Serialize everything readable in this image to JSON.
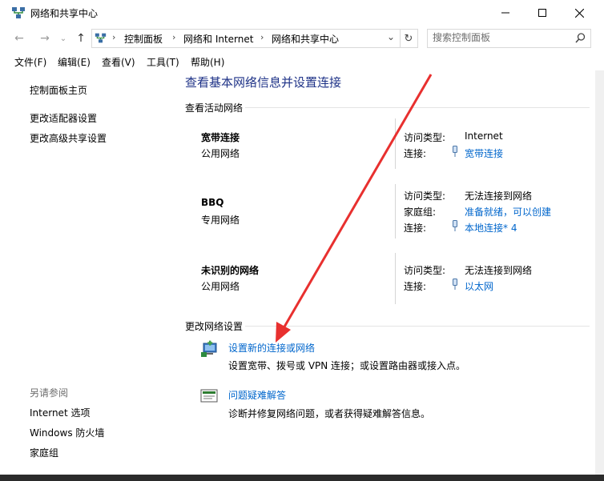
{
  "window": {
    "title": "网络和共享中心",
    "minimize_label": "Minimize",
    "maximize_label": "Maximize",
    "close_label": "Close"
  },
  "address": {
    "crumbs": [
      "控制面板",
      "网络和 Internet",
      "网络和共享中心"
    ],
    "search_placeholder": "搜索控制面板"
  },
  "menu": [
    "文件(F)",
    "编辑(E)",
    "查看(V)",
    "工具(T)",
    "帮助(H)"
  ],
  "sidebar": {
    "links": [
      "控制面板主页",
      "更改适配器设置",
      "更改高级共享设置"
    ],
    "see_also_title": "另请参阅",
    "see_also": [
      "Internet 选项",
      "Windows 防火墙",
      "家庭组"
    ]
  },
  "main": {
    "title": "查看基本网络信息并设置连接",
    "active_heading": "查看活动网络",
    "networks": [
      {
        "name": "宽带连接",
        "type": "公用网络",
        "rows": [
          {
            "label": "访问类型:",
            "value": "Internet",
            "link": false
          },
          {
            "label": "连接:",
            "value": "宽带连接",
            "link": true,
            "icon": "connection-icon"
          }
        ]
      },
      {
        "name": "BBQ",
        "type": "专用网络",
        "rows": [
          {
            "label": "访问类型:",
            "value": "无法连接到网络",
            "link": false
          },
          {
            "label": "家庭组:",
            "value": "准备就绪，可以创建",
            "link": true
          },
          {
            "label": "连接:",
            "value": "本地连接* 4",
            "link": true,
            "icon": "connection-icon"
          }
        ]
      },
      {
        "name": "未识别的网络",
        "type": "公用网络",
        "rows": [
          {
            "label": "访问类型:",
            "value": "无法连接到网络",
            "link": false
          },
          {
            "label": "连接:",
            "value": "以太网",
            "link": true,
            "icon": "connection-icon"
          }
        ]
      }
    ],
    "change_heading": "更改网络设置",
    "tasks": [
      {
        "link": "设置新的连接或网络",
        "desc": "设置宽带、拨号或 VPN 连接；或设置路由器或接入点。"
      },
      {
        "link": "问题疑难解答",
        "desc": "诊断并修复网络问题，或者获得疑难解答信息。"
      }
    ]
  },
  "colors": {
    "link": "#0066cc",
    "title": "#1e3287",
    "annotation_arrow": "#e8302f"
  }
}
